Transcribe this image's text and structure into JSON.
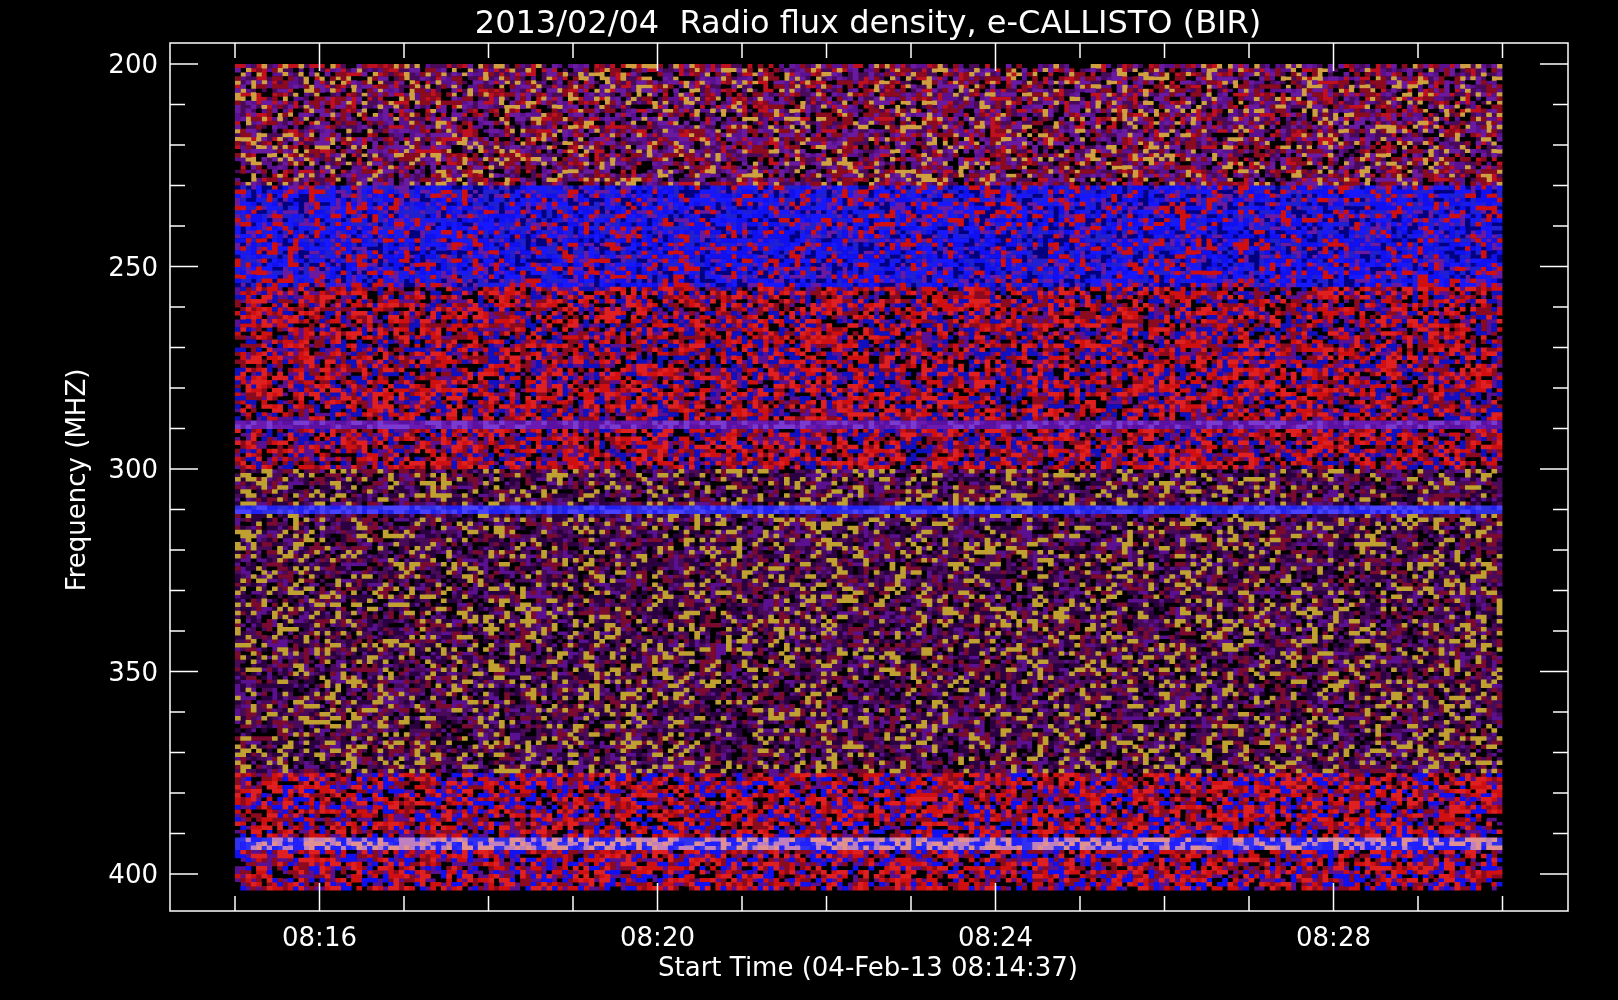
{
  "plot": {
    "title": "2013/02/04  Radio flux density, e-CALLISTO (BIR)",
    "ylabel": "Frequency (MHZ)",
    "xlabel": "Start Time (04-Feb-13 08:14:37)",
    "y_tick_labels": [
      "200",
      "250",
      "300",
      "350",
      "400"
    ],
    "x_tick_labels": [
      "08:16",
      "08:20",
      "08:24",
      "08:28"
    ]
  }
}
